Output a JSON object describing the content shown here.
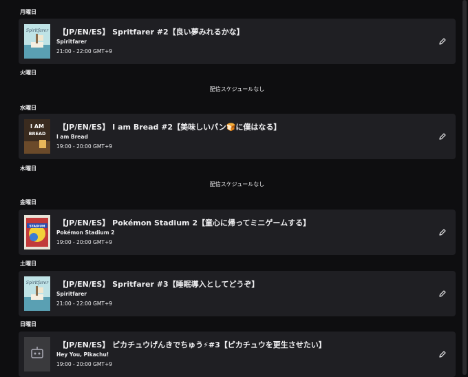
{
  "days": [
    {
      "label": "月曜日"
    },
    {
      "label": "火曜日"
    },
    {
      "label": "水曜日"
    },
    {
      "label": "木曜日"
    },
    {
      "label": "金曜日"
    },
    {
      "label": "土曜日"
    },
    {
      "label": "日曜日"
    }
  ],
  "empty_text": "配信スケジュールなし",
  "streams": [
    {
      "flower": "🌸",
      "title": "【JP/EN/ES】 Spritfarer #2【良い夢みれるかな】",
      "game": "Spiritfarer",
      "time": "21:00 - 22:00 GMT+9",
      "thumb_text": "Spiritfarer"
    },
    {
      "flower": "🌸",
      "title": "【JP/EN/ES】 I am Bread #2【美味しいパン🍞に僕はなる】",
      "game": "I am Bread",
      "time": "19:00 - 20:00 GMT+9",
      "thumb_text": "I AM BREAD"
    },
    {
      "flower": "🌸",
      "title": "【JP/EN/ES】 Pokémon Stadium 2【童心に帰ってミニゲームする】",
      "game": "Pokémon Stadium 2",
      "time": "19:00 - 20:00 GMT+9",
      "thumb_text": "STADIUM"
    },
    {
      "flower": "🌸",
      "title": "【JP/EN/ES】 Spritfarer #3【睡眠導入としてどうぞ】",
      "game": "Spiritfarer",
      "time": "21:00 - 22:00 GMT+9",
      "thumb_text": "Spiritfarer"
    },
    {
      "flower": "🌸",
      "title": "【JP/EN/ES】 ピカチュウげんきでちゅう⚡#3【ピカチュウを更生させたい】",
      "game": "Hey You, Pikachu!",
      "time": "19:00 - 20:00 GMT+9",
      "thumb_text": ""
    }
  ],
  "colors": {
    "background": "#0e0e10",
    "card": "#1f1f23",
    "accent_flower": "#ff7eb6"
  }
}
